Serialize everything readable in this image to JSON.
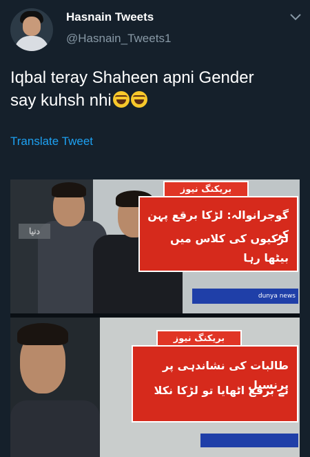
{
  "tweet": {
    "display_name": "Hasnain Tweets",
    "handle": "@Hasnain_Tweets1",
    "text_line1": "Iqbal teray Shaheen apni Gender",
    "text_line2": "say kuhsh nhi",
    "translate_label": "Translate Tweet"
  },
  "icons": {
    "menu": "chevron-down-icon",
    "emoji": "tears-of-joy-emoji"
  },
  "media": {
    "top_banner_tab": "بریکنگ نیوز",
    "top_banner_line1": "گوجرانوالہ: لڑکا برقع پہن کر",
    "top_banner_line2": "لڑکیوں کی کلاس میں بیٹھا رہا",
    "top_logo": "دنیا",
    "ticker": "dunya news",
    "bottom_banner_tab": "بریکنگ نیوز",
    "bottom_banner_line1": "طالبات کی نشاندہی پر پرنسپل",
    "bottom_banner_line2": "نے برقع اٹھایا تو لڑکا نکلا"
  },
  "colors": {
    "background": "#15202b",
    "link": "#1da1f2",
    "secondary_text": "#8899a6",
    "banner_red": "#d62a1c"
  }
}
